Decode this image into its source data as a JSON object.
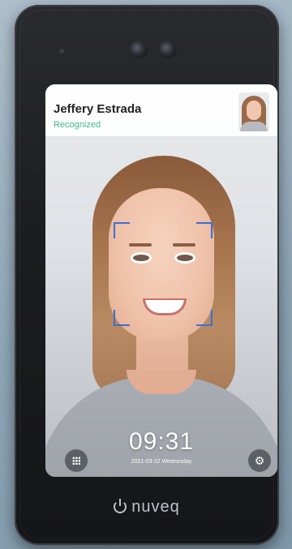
{
  "header": {
    "name": "Jeffery Estrada",
    "status": "Recognized",
    "status_color": "#42b98a"
  },
  "clock": {
    "time": "09:31",
    "date": "2021-03-22 Wednesday"
  },
  "controls": {
    "apps_icon": "grid-icon",
    "settings_icon": "gear-icon"
  },
  "brand": {
    "logo_text": "nuveq",
    "logo_icon": "power-icon"
  },
  "colors": {
    "face_frame": "#3a6fd8",
    "device_body": "#1b1c1f"
  }
}
